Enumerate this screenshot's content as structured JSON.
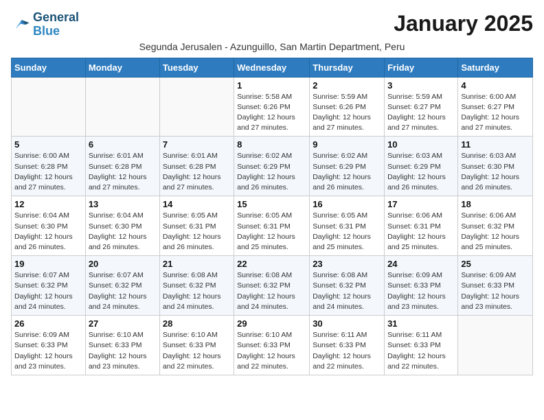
{
  "header": {
    "logo_line1": "General",
    "logo_line2": "Blue",
    "month_title": "January 2025",
    "subtitle": "Segunda Jerusalen - Azunguillo, San Martin Department, Peru"
  },
  "weekdays": [
    "Sunday",
    "Monday",
    "Tuesday",
    "Wednesday",
    "Thursday",
    "Friday",
    "Saturday"
  ],
  "weeks": [
    [
      {
        "day": "",
        "info": ""
      },
      {
        "day": "",
        "info": ""
      },
      {
        "day": "",
        "info": ""
      },
      {
        "day": "1",
        "info": "Sunrise: 5:58 AM\nSunset: 6:26 PM\nDaylight: 12 hours\nand 27 minutes."
      },
      {
        "day": "2",
        "info": "Sunrise: 5:59 AM\nSunset: 6:26 PM\nDaylight: 12 hours\nand 27 minutes."
      },
      {
        "day": "3",
        "info": "Sunrise: 5:59 AM\nSunset: 6:27 PM\nDaylight: 12 hours\nand 27 minutes."
      },
      {
        "day": "4",
        "info": "Sunrise: 6:00 AM\nSunset: 6:27 PM\nDaylight: 12 hours\nand 27 minutes."
      }
    ],
    [
      {
        "day": "5",
        "info": "Sunrise: 6:00 AM\nSunset: 6:28 PM\nDaylight: 12 hours\nand 27 minutes."
      },
      {
        "day": "6",
        "info": "Sunrise: 6:01 AM\nSunset: 6:28 PM\nDaylight: 12 hours\nand 27 minutes."
      },
      {
        "day": "7",
        "info": "Sunrise: 6:01 AM\nSunset: 6:28 PM\nDaylight: 12 hours\nand 27 minutes."
      },
      {
        "day": "8",
        "info": "Sunrise: 6:02 AM\nSunset: 6:29 PM\nDaylight: 12 hours\nand 26 minutes."
      },
      {
        "day": "9",
        "info": "Sunrise: 6:02 AM\nSunset: 6:29 PM\nDaylight: 12 hours\nand 26 minutes."
      },
      {
        "day": "10",
        "info": "Sunrise: 6:03 AM\nSunset: 6:29 PM\nDaylight: 12 hours\nand 26 minutes."
      },
      {
        "day": "11",
        "info": "Sunrise: 6:03 AM\nSunset: 6:30 PM\nDaylight: 12 hours\nand 26 minutes."
      }
    ],
    [
      {
        "day": "12",
        "info": "Sunrise: 6:04 AM\nSunset: 6:30 PM\nDaylight: 12 hours\nand 26 minutes."
      },
      {
        "day": "13",
        "info": "Sunrise: 6:04 AM\nSunset: 6:30 PM\nDaylight: 12 hours\nand 26 minutes."
      },
      {
        "day": "14",
        "info": "Sunrise: 6:05 AM\nSunset: 6:31 PM\nDaylight: 12 hours\nand 26 minutes."
      },
      {
        "day": "15",
        "info": "Sunrise: 6:05 AM\nSunset: 6:31 PM\nDaylight: 12 hours\nand 25 minutes."
      },
      {
        "day": "16",
        "info": "Sunrise: 6:05 AM\nSunset: 6:31 PM\nDaylight: 12 hours\nand 25 minutes."
      },
      {
        "day": "17",
        "info": "Sunrise: 6:06 AM\nSunset: 6:31 PM\nDaylight: 12 hours\nand 25 minutes."
      },
      {
        "day": "18",
        "info": "Sunrise: 6:06 AM\nSunset: 6:32 PM\nDaylight: 12 hours\nand 25 minutes."
      }
    ],
    [
      {
        "day": "19",
        "info": "Sunrise: 6:07 AM\nSunset: 6:32 PM\nDaylight: 12 hours\nand 24 minutes."
      },
      {
        "day": "20",
        "info": "Sunrise: 6:07 AM\nSunset: 6:32 PM\nDaylight: 12 hours\nand 24 minutes."
      },
      {
        "day": "21",
        "info": "Sunrise: 6:08 AM\nSunset: 6:32 PM\nDaylight: 12 hours\nand 24 minutes."
      },
      {
        "day": "22",
        "info": "Sunrise: 6:08 AM\nSunset: 6:32 PM\nDaylight: 12 hours\nand 24 minutes."
      },
      {
        "day": "23",
        "info": "Sunrise: 6:08 AM\nSunset: 6:32 PM\nDaylight: 12 hours\nand 24 minutes."
      },
      {
        "day": "24",
        "info": "Sunrise: 6:09 AM\nSunset: 6:33 PM\nDaylight: 12 hours\nand 23 minutes."
      },
      {
        "day": "25",
        "info": "Sunrise: 6:09 AM\nSunset: 6:33 PM\nDaylight: 12 hours\nand 23 minutes."
      }
    ],
    [
      {
        "day": "26",
        "info": "Sunrise: 6:09 AM\nSunset: 6:33 PM\nDaylight: 12 hours\nand 23 minutes."
      },
      {
        "day": "27",
        "info": "Sunrise: 6:10 AM\nSunset: 6:33 PM\nDaylight: 12 hours\nand 23 minutes."
      },
      {
        "day": "28",
        "info": "Sunrise: 6:10 AM\nSunset: 6:33 PM\nDaylight: 12 hours\nand 22 minutes."
      },
      {
        "day": "29",
        "info": "Sunrise: 6:10 AM\nSunset: 6:33 PM\nDaylight: 12 hours\nand 22 minutes."
      },
      {
        "day": "30",
        "info": "Sunrise: 6:11 AM\nSunset: 6:33 PM\nDaylight: 12 hours\nand 22 minutes."
      },
      {
        "day": "31",
        "info": "Sunrise: 6:11 AM\nSunset: 6:33 PM\nDaylight: 12 hours\nand 22 minutes."
      },
      {
        "day": "",
        "info": ""
      }
    ]
  ]
}
